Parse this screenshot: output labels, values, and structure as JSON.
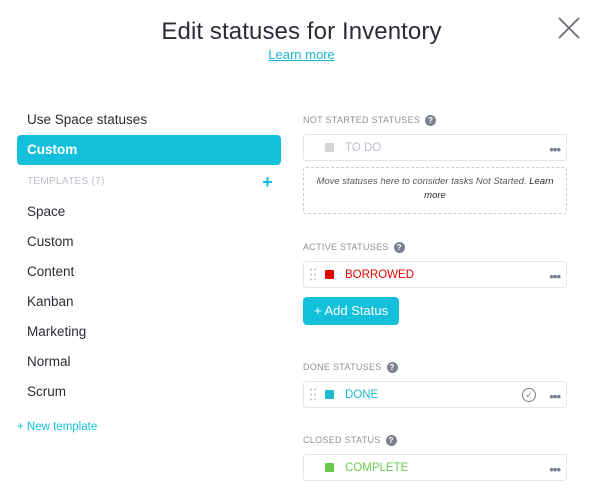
{
  "header": {
    "title": "Edit statuses for Inventory",
    "learn_more": "Learn more"
  },
  "sidebar": {
    "use_space": "Use Space statuses",
    "custom_active": "Custom",
    "templates_heading": "TEMPLATES (7)",
    "templates": [
      "Space",
      "Custom",
      "Content",
      "Kanban",
      "Marketing",
      "Normal",
      "Scrum"
    ],
    "new_template": "+ New template"
  },
  "sections": {
    "not_started": {
      "label": "NOT STARTED STATUSES",
      "status": {
        "name": "TO DO",
        "color": "#d3d3d3",
        "text_color": "#b9bec7"
      },
      "dropzone_text": "Move statuses here to consider tasks Not Started.",
      "dropzone_link": "Learn more"
    },
    "active": {
      "label": "ACTIVE STATUSES",
      "status": {
        "name": "BORROWED",
        "color": "#e50000",
        "text_color": "#e50000"
      },
      "add_button": "+ Add Status"
    },
    "done": {
      "label": "DONE STATUSES",
      "status": {
        "name": "DONE",
        "color": "#1bbcd0",
        "text_color": "#1bbcd0"
      }
    },
    "closed": {
      "label": "CLOSED STATUS",
      "status": {
        "name": "COMPLETE",
        "color": "#6bc950",
        "text_color": "#6bc950"
      }
    }
  },
  "icons": {
    "close": "close-icon",
    "help": "question-icon",
    "menu": "more-dots-icon",
    "drag": "drag-handle-icon",
    "check": "check-circle-icon"
  },
  "colors": {
    "accent": "#12c0dc"
  }
}
